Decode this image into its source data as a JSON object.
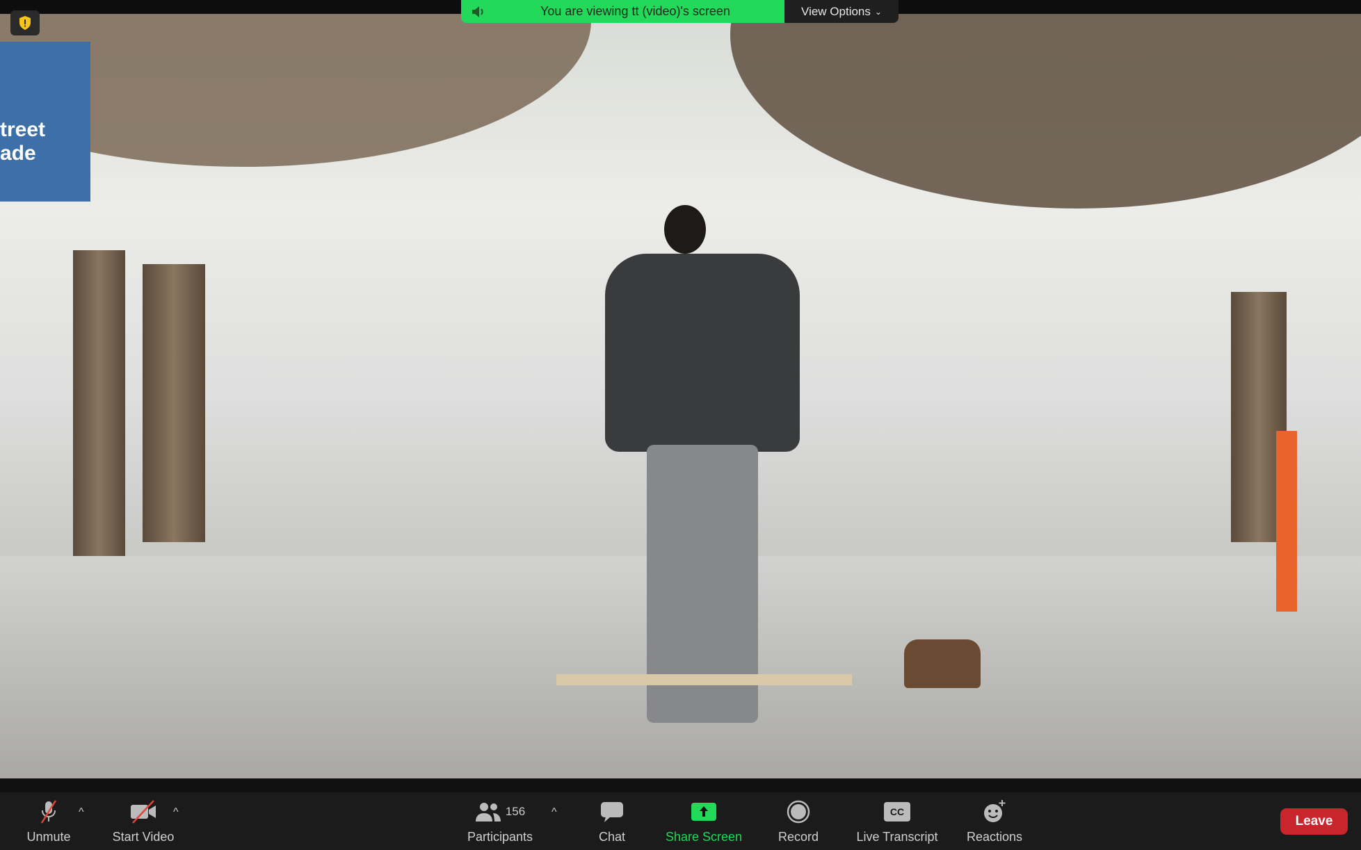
{
  "banner": {
    "text": "You are viewing tt (video)'s screen",
    "color": "#22d95a",
    "icon": "speaker-icon"
  },
  "view_options": {
    "label": "View Options",
    "icon": "chevron-down-icon"
  },
  "security_icon": "shield-icon",
  "video_sign_text": "treet\nade",
  "toolbar": {
    "unmute": "Unmute",
    "start_video": "Start Video",
    "participants": "Participants",
    "participant_count": "156",
    "chat": "Chat",
    "share_screen": "Share Screen",
    "record": "Record",
    "live_transcript": "Live Transcript",
    "cc": "CC",
    "reactions": "Reactions",
    "leave": "Leave",
    "share_color": "#22d95a",
    "leave_color": "#c8262a"
  }
}
